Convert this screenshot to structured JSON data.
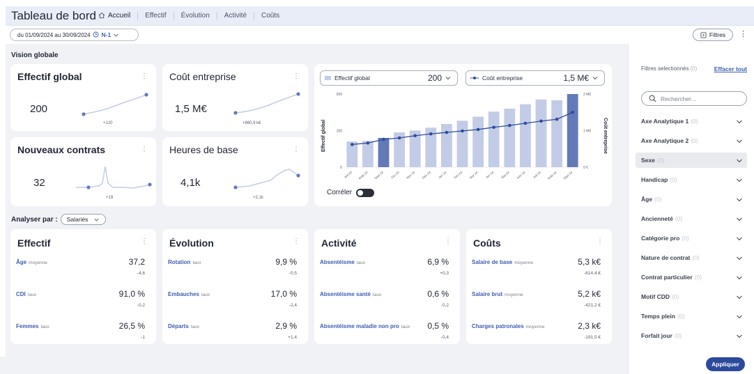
{
  "header": {
    "title": "Tableau de bord",
    "nav": [
      "Accueil",
      "Effectif",
      "Évolution",
      "Activité",
      "Coûts"
    ]
  },
  "subbar": {
    "date_range": "du 01/09/2024 au 30/09/2024",
    "compare_label": "N-1",
    "filters_label": "Filtres"
  },
  "vision": {
    "title": "Vision globale",
    "kpis": [
      {
        "title": "Effectif global",
        "value": "200",
        "delta": "+120"
      },
      {
        "title": "Coût entreprise",
        "value": "1,5 M€",
        "delta": "+860,9 k€"
      },
      {
        "title": "Nouveaux contrats",
        "value": "32",
        "delta": "+19"
      },
      {
        "title": "Heures de base",
        "value": "4,1k",
        "delta": "+2,1k"
      }
    ]
  },
  "chart_panel": {
    "left_select": {
      "label": "Effectif global",
      "value": "200"
    },
    "right_select": {
      "label": "Coût entreprise",
      "value": "1,5 M€"
    },
    "correler_label": "Corréler"
  },
  "chart_data": {
    "type": "bar",
    "categories": [
      "Juil 23",
      "Août 23",
      "Sept 23",
      "Oct 23",
      "Nov 23",
      "Déc 23",
      "Jan 24",
      "Fév 24",
      "Mar 24",
      "Avr 24",
      "Mai 24",
      "Juin 24",
      "Juil 24",
      "Août 24",
      "Sept 24"
    ],
    "series": [
      {
        "name": "Effectif global",
        "type": "bar",
        "axis": "left",
        "values": [
          70,
          72,
          80,
          95,
          100,
          108,
          118,
          127,
          138,
          152,
          160,
          172,
          185,
          183,
          200
        ],
        "highlight": [
          2,
          14
        ]
      },
      {
        "name": "Coût entreprise",
        "type": "line",
        "axis": "right",
        "values": [
          0.62,
          0.66,
          0.76,
          0.8,
          0.86,
          0.91,
          0.95,
          0.99,
          1.03,
          1.09,
          1.14,
          1.2,
          1.26,
          1.31,
          1.5
        ]
      }
    ],
    "ylabel": "Effectif global",
    "y2label": "Coût entreprise",
    "ylim": [
      0,
      200
    ],
    "y2lim": [
      0,
      2
    ],
    "yticks": [
      "0",
      "100",
      "200"
    ],
    "y2ticks": [
      "0 €",
      "1 M€",
      "2 M€"
    ],
    "colors": {
      "bar": "#c3cce6",
      "bar_highlight": "#6479b8",
      "line": "#2f4c9d"
    }
  },
  "analyse": {
    "label": "Analyser par :",
    "selected": "Salariés",
    "cards": [
      {
        "title": "Effectif",
        "rows": [
          {
            "label": "Âge",
            "unit": "moyenne",
            "value": "37,2",
            "delta": "-4,6"
          },
          {
            "label": "CDI",
            "unit": "taux",
            "value": "91,0 %",
            "delta": "-0,2"
          },
          {
            "label": "Femmes",
            "unit": "taux",
            "value": "26,5 %",
            "delta": "-1"
          }
        ]
      },
      {
        "title": "Évolution",
        "rows": [
          {
            "label": "Rotation",
            "unit": "taux",
            "value": "9,9 %",
            "delta": "-0,5"
          },
          {
            "label": "Embauches",
            "unit": "taux",
            "value": "17,0 %",
            "delta": "-2,4"
          },
          {
            "label": "Départs",
            "unit": "taux",
            "value": "2,9 %",
            "delta": "+1,4"
          }
        ]
      },
      {
        "title": "Activité",
        "rows": [
          {
            "label": "Absentéisme",
            "unit": "taux",
            "value": "6,9 %",
            "delta": "+0,3"
          },
          {
            "label": "Absentéisme santé",
            "unit": "taux",
            "value": "0,6 %",
            "delta": "-0,2"
          },
          {
            "label": "Absentéisme maladie non pro",
            "unit": "taux",
            "value": "0,5 %",
            "delta": "-0,4"
          }
        ]
      },
      {
        "title": "Coûts",
        "rows": [
          {
            "label": "Salaire de base",
            "unit": "moyenne",
            "value": "5,3 k€",
            "delta": "-614,4 €"
          },
          {
            "label": "Salaire brut",
            "unit": "moyenne",
            "value": "5,2 k€",
            "delta": "-421,2 €"
          },
          {
            "label": "Charges patronales",
            "unit": "moyenne",
            "value": "2,3 k€",
            "delta": "-191,5 €"
          }
        ]
      }
    ]
  },
  "sidebar": {
    "header": "Filtres selectionnés",
    "header_count": "(0)",
    "clear_label": "Effacer tout",
    "search_placeholder": "Rechercher...",
    "items": [
      {
        "label": "Axe Analytique 1",
        "count": "(0)"
      },
      {
        "label": "Axe Analytique 2",
        "count": "(0)"
      },
      {
        "label": "Sexe",
        "count": "(0)"
      },
      {
        "label": "Handicap",
        "count": "(0)"
      },
      {
        "label": "Âge",
        "count": "(0)"
      },
      {
        "label": "Ancienneté",
        "count": "(0)"
      },
      {
        "label": "Catégorie pro",
        "count": "(0)"
      },
      {
        "label": "Nature de contrat",
        "count": "(0)"
      },
      {
        "label": "Contrat particulier",
        "count": "(0)"
      },
      {
        "label": "Motif CDD",
        "count": "(0)"
      },
      {
        "label": "Temps plein",
        "count": "(0)"
      },
      {
        "label": "Forfait jour",
        "count": "(0)"
      }
    ],
    "apply_label": "Appliquer"
  }
}
